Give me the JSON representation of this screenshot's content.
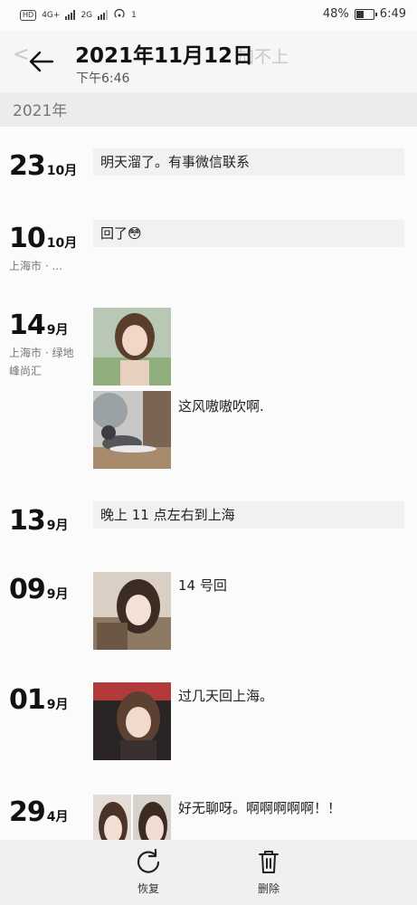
{
  "status_bar": {
    "hd_badge": "HD",
    "net1": "4G+",
    "net2": "2G",
    "hotspot_count": "1",
    "battery_text": "48%",
    "battery_level": 0.48,
    "time": "6:49"
  },
  "header": {
    "title": "2021年11月12日",
    "subtitle": "下午6:46",
    "ghost_left": "<",
    "ghost_right": "加不上"
  },
  "year_label": "2021年",
  "entries": [
    {
      "day": "23",
      "month": "10月",
      "text": "明天溜了。有事微信联系"
    },
    {
      "day": "10",
      "month": "10月",
      "text": "回了😳",
      "location": "上海市 · ..."
    },
    {
      "day": "14",
      "month": "9月",
      "location": "上海市 · 绿地峰尚汇",
      "photo_caption": "这风嗷嗷吹啊."
    },
    {
      "day": "13",
      "month": "9月",
      "text": "晚上 11 点左右到上海"
    },
    {
      "day": "09",
      "month": "9月",
      "caption": "14 号回"
    },
    {
      "day": "01",
      "month": "9月",
      "caption": "过几天回上海。"
    },
    {
      "day": "29",
      "month": "4月",
      "caption": "好无聊呀。啊啊啊啊啊！！"
    }
  ],
  "actions": {
    "restore_label": "恢复",
    "delete_label": "删除"
  }
}
